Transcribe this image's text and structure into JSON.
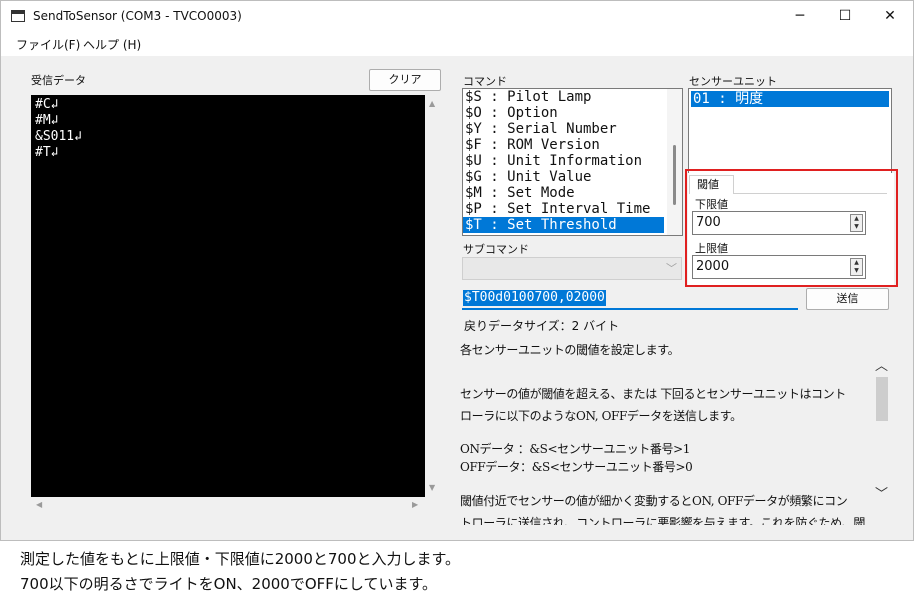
{
  "window": {
    "title": "SendToSensor (COM3 - TVCO0003)",
    "controls": {
      "minimize": "─",
      "maximize": "☐",
      "close": "✕"
    }
  },
  "menu": [
    "ファイル(F)",
    "ヘルプ (H)"
  ],
  "receive": {
    "label": "受信データ",
    "clear_button": "クリア",
    "lines": [
      "#C↲",
      "#M↲",
      "&S011↲",
      "#T↲"
    ]
  },
  "command": {
    "label": "コマンド",
    "items": [
      "$S : Pilot Lamp",
      "$O : Option",
      "$Y : Serial Number",
      "$F : ROM Version",
      "$U : Unit Information",
      "$G : Unit Value",
      "$M : Set Mode",
      "$P : Set Interval Time",
      "$T : Set Threshold"
    ],
    "selected_index": 8
  },
  "sensor_unit": {
    "label": "センサーユニット",
    "items": [
      "01 : 明度"
    ]
  },
  "threshold": {
    "tab": "閾値",
    "lower_label": "下限値",
    "lower_value": "700",
    "upper_label": "上限値",
    "upper_value": "2000"
  },
  "sub_command": {
    "label": "サブコマンド",
    "value": ""
  },
  "command_string": "$T00d0100700,02000",
  "send_button": "送信",
  "return_size": "戻りデータサイズ：2 バイト",
  "description": [
    "各センサーユニットの閾値を設定します。",
    "センサーの値が閾値を超える、または 下回るとセンサーユニットはコント",
    "ローラに以下のようなON, OFFデータを送信します。",
    "ONデータ ：&S<センサーユニット番号>1",
    "OFFデータ：&S<センサーユニット番号>0",
    "閾値付近でセンサーの値が細かく変動するとON, OFFデータが頻繁にコン",
    "トローラに送信され、コントローラに悪影響を与えます。これを防ぐため、閾"
  ],
  "caption": [
    "測定した値をもとに上限値・下限値に2000と700と入力します。",
    "700以下の明るさでライトをON、2000でOFFにしています。"
  ],
  "colors": {
    "selection": "#0078d7",
    "highlight_frame": "#e02020",
    "terminal_bg": "#000000"
  }
}
